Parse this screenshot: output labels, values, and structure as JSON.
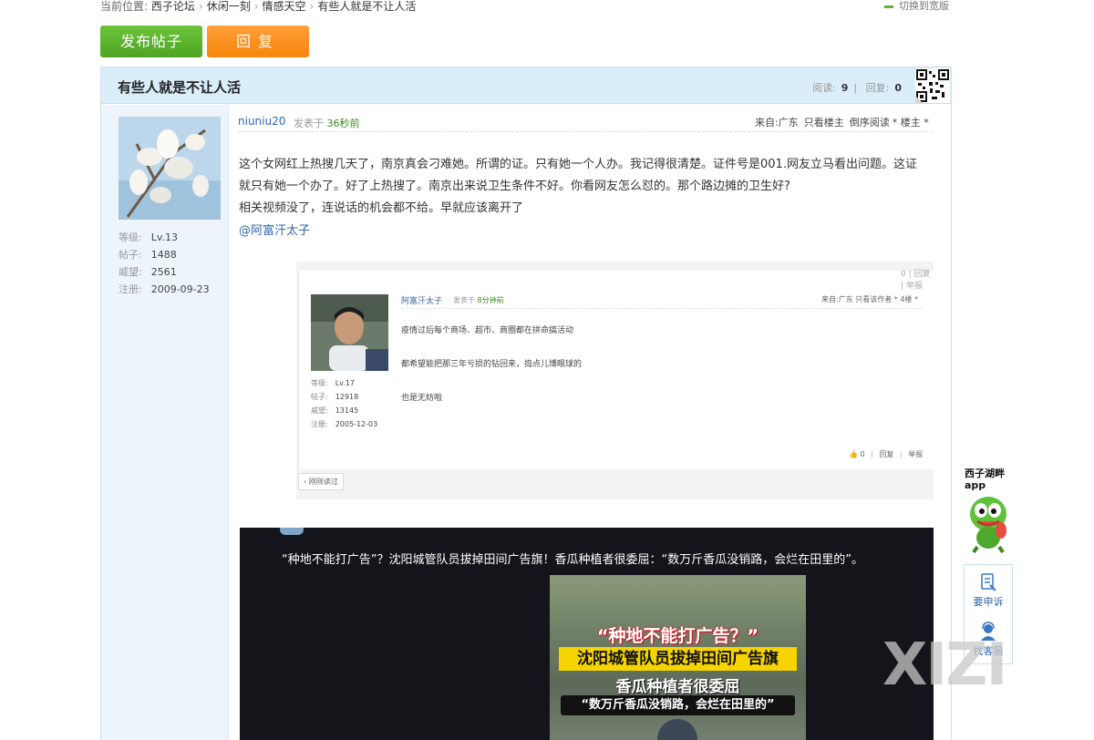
{
  "breadcrumb": {
    "prefix": "当前位置:",
    "items": [
      "西子论坛",
      "休闲一刻",
      "情感天空",
      "有些人就是不让人活"
    ],
    "separator": "›"
  },
  "wide_switch": "切换到宽版",
  "toolbar": {
    "post_label": "发布帖子",
    "reply_label": "回复"
  },
  "thread": {
    "title": "有些人就是不让人活",
    "read_label": "阅读:",
    "read_count": "9",
    "reply_label": "回复:",
    "reply_count": "0",
    "stat_sep": "|"
  },
  "author": {
    "name": "niuniu20",
    "level_label": "等级:",
    "level": "Lv.13",
    "posts_label": "帖子:",
    "posts": "1488",
    "prestige_label": "威望:",
    "prestige": "2561",
    "reg_label": "注册:",
    "reg_date": "2009-09-23"
  },
  "post": {
    "posted_prefix": "发表于",
    "posted_ago": "36秒前",
    "from": "来自:广东",
    "only_author": "只看楼主",
    "reverse": "倒序阅读",
    "floor": "* 楼主 *",
    "lines": [
      "这个女网红上热搜几天了，南京真会刁难她。所谓的证。只有她一个人办。我记得很清楚。证件号是001.网友立马看出问题。这证",
      "就只有她一个办了。好了上热搜了。南京出来说卫生条件不好。你看网友怎么怼的。那个路边摊的卫生好?",
      "相关视频没了，连说话的机会都不给。早就应该离开了"
    ],
    "mention": "@阿富汗太子"
  },
  "embedded": {
    "top_bar": "0 | 回复 | 举报",
    "name": "阿富汗太子",
    "posted_prefix": "发表于",
    "posted_ago": "8分钟前",
    "from": "来自:广东 只看该作者 * 4楼 *",
    "lines": [
      "疫情过后每个商场、超市、商圈都在拼命搞活动",
      "都希望能把那三年亏损的钻回来，捣点儿博眼球的",
      "也是无妨啦"
    ],
    "level_label": "等级:",
    "level": "Lv.17",
    "posts_label": "帖子:",
    "posts": "12918",
    "prestige_label": "威望:",
    "prestige": "13145",
    "reg_label": "注册:",
    "reg_date": "2005-12-03",
    "like_count": "0",
    "reply": "回复",
    "report": "举报",
    "back": "‹ 刚刚读过"
  },
  "video": {
    "caption": "“种地不能打广告”？沈阳城管队员拔掉田间广告旗！香瓜种植者很委屈：“数万斤香瓜没销路，会烂在田里的”。",
    "title1": "“种地不能打广告？”",
    "title2": "沈阳城管队员拔掉田间广告旗",
    "title3": "香瓜种植者很委屈",
    "title4": "“数万斤香瓜没销路，会烂在田里的”"
  },
  "sidebar_widget": {
    "app_line1": "西子湖畔",
    "app_line2": "app",
    "complaint": "要申诉",
    "service": "找客服"
  },
  "watermark": "XIZI",
  "colors": {
    "green_button": "#5cb531",
    "orange_button": "#f6850c",
    "title_bar": "#daeefa",
    "link": "#3366aa"
  }
}
